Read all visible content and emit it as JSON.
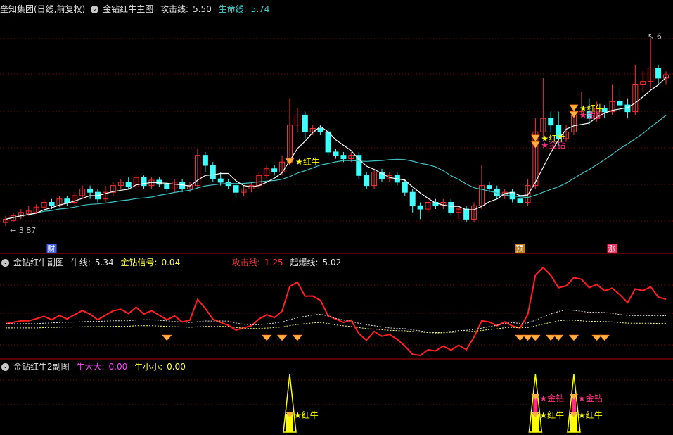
{
  "header_main": {
    "stock": "垒知集团(日线,前复权)",
    "indicator": "金钻红牛主图",
    "attack_label": "攻击线:",
    "attack_value": "5.50",
    "life_label": "生命线:",
    "life_value": "5.74"
  },
  "header_sub1": {
    "indicator": "金钻红牛副图",
    "bull_label": "牛线:",
    "bull_value": "5.34",
    "signal_label": "金钻信号:",
    "signal_value": "0.04",
    "attack_label": "攻击线:",
    "attack_value": "1.25",
    "burst_label": "起爆线:",
    "burst_value": "5.02"
  },
  "header_sub2": {
    "indicator": "金钻红牛2副图",
    "big_label": "牛大大:",
    "big_value": "0.00",
    "small_label": "牛小小:",
    "small_value": "0.00"
  },
  "colors": {
    "up": "#ff3030",
    "down": "#40ffff",
    "ma_attack": "#ffffff",
    "ma_life": "#40c0c0",
    "red_line": "#ff2020",
    "dashed_white": "#e0e0e0",
    "dashed_yellow": "#ffff60",
    "signal_yellow": "#ffff00",
    "tag_pink": "#ff3080",
    "grid": "#8b0000"
  },
  "chart_data": {
    "type": "candlestick",
    "min_label": "3.87",
    "max_label": "6",
    "candles": [
      [
        3.95,
        4.0,
        3.9,
        4.05
      ],
      [
        3.98,
        4.05,
        3.95,
        4.1
      ],
      [
        4.03,
        4.1,
        4.0,
        4.15
      ],
      [
        4.08,
        4.12,
        4.05,
        4.2
      ],
      [
        4.1,
        4.18,
        4.08,
        4.22
      ],
      [
        4.18,
        4.25,
        4.15,
        4.3
      ],
      [
        4.25,
        4.2,
        4.15,
        4.3
      ],
      [
        4.2,
        4.3,
        4.18,
        4.35
      ],
      [
        4.3,
        4.25,
        4.2,
        4.35
      ],
      [
        4.25,
        4.35,
        4.2,
        4.4
      ],
      [
        4.35,
        4.45,
        4.3,
        4.5
      ],
      [
        4.45,
        4.4,
        4.3,
        4.5
      ],
      [
        4.4,
        4.3,
        4.25,
        4.45
      ],
      [
        4.3,
        4.4,
        4.25,
        4.5
      ],
      [
        4.4,
        4.5,
        4.35,
        4.55
      ],
      [
        4.5,
        4.55,
        4.45,
        4.6
      ],
      [
        4.55,
        4.48,
        4.45,
        4.62
      ],
      [
        4.48,
        4.62,
        4.45,
        4.65
      ],
      [
        4.62,
        4.5,
        4.45,
        4.65
      ],
      [
        4.5,
        4.58,
        4.45,
        4.62
      ],
      [
        4.58,
        4.52,
        4.48,
        4.62
      ],
      [
        4.52,
        4.45,
        4.4,
        4.55
      ],
      [
        4.45,
        4.55,
        4.4,
        4.6
      ],
      [
        4.55,
        4.45,
        4.4,
        4.6
      ],
      [
        4.45,
        4.5,
        4.4,
        4.55
      ],
      [
        4.5,
        4.95,
        4.45,
        5.05
      ],
      [
        4.95,
        4.8,
        4.7,
        5.0
      ],
      [
        4.8,
        4.6,
        4.55,
        4.85
      ],
      [
        4.6,
        4.55,
        4.5,
        4.7
      ],
      [
        4.55,
        4.5,
        4.45,
        4.6
      ],
      [
        4.5,
        4.4,
        4.3,
        4.55
      ],
      [
        4.4,
        4.45,
        4.35,
        4.5
      ],
      [
        4.45,
        4.5,
        4.4,
        4.55
      ],
      [
        4.5,
        4.65,
        4.45,
        4.7
      ],
      [
        4.65,
        4.75,
        4.6,
        4.8
      ],
      [
        4.75,
        4.7,
        4.65,
        4.8
      ],
      [
        4.7,
        4.85,
        4.65,
        4.95
      ],
      [
        4.85,
        5.4,
        4.8,
        5.8
      ],
      [
        5.4,
        5.55,
        5.3,
        5.65
      ],
      [
        5.55,
        5.3,
        5.2,
        5.6
      ],
      [
        5.3,
        5.35,
        5.25,
        5.4
      ],
      [
        5.35,
        5.3,
        5.25,
        5.4
      ],
      [
        5.3,
        5.0,
        4.95,
        5.35
      ],
      [
        5.0,
        4.95,
        4.9,
        5.05
      ],
      [
        4.95,
        4.9,
        4.85,
        5.0
      ],
      [
        4.9,
        4.95,
        4.85,
        5.0
      ],
      [
        4.95,
        4.65,
        4.6,
        5.0
      ],
      [
        4.65,
        4.5,
        4.45,
        4.7
      ],
      [
        4.5,
        4.7,
        4.45,
        4.75
      ],
      [
        4.7,
        4.6,
        4.55,
        4.75
      ],
      [
        4.6,
        4.65,
        4.55,
        4.7
      ],
      [
        4.65,
        4.55,
        4.5,
        4.7
      ],
      [
        4.55,
        4.4,
        4.35,
        4.6
      ],
      [
        4.4,
        4.2,
        4.1,
        4.45
      ],
      [
        4.2,
        4.15,
        4.0,
        4.25
      ],
      [
        4.15,
        4.25,
        4.1,
        4.3
      ],
      [
        4.25,
        4.2,
        4.15,
        4.3
      ],
      [
        4.2,
        4.25,
        4.15,
        4.3
      ],
      [
        4.25,
        4.1,
        4.05,
        4.3
      ],
      [
        4.1,
        4.15,
        4.0,
        4.2
      ],
      [
        4.15,
        4.0,
        3.95,
        4.2
      ],
      [
        4.0,
        4.2,
        3.95,
        4.25
      ],
      [
        4.2,
        4.5,
        4.15,
        4.8
      ],
      [
        4.5,
        4.45,
        4.4,
        4.55
      ],
      [
        4.45,
        4.35,
        4.3,
        4.5
      ],
      [
        4.35,
        4.4,
        4.3,
        4.45
      ],
      [
        4.4,
        4.3,
        4.25,
        4.45
      ],
      [
        4.3,
        4.25,
        4.2,
        4.35
      ],
      [
        4.25,
        4.5,
        4.2,
        4.6
      ],
      [
        4.5,
        5.3,
        4.45,
        5.5
      ],
      [
        5.3,
        5.5,
        5.2,
        6.1
      ],
      [
        5.5,
        5.4,
        5.3,
        5.6
      ],
      [
        5.4,
        5.2,
        5.1,
        5.6
      ],
      [
        5.2,
        5.3,
        5.15,
        5.4
      ],
      [
        5.3,
        5.55,
        5.25,
        5.6
      ],
      [
        5.55,
        5.6,
        5.5,
        5.9
      ],
      [
        5.6,
        5.5,
        5.4,
        5.8
      ],
      [
        5.5,
        5.65,
        5.45,
        5.75
      ],
      [
        5.65,
        5.6,
        5.5,
        5.7
      ],
      [
        5.6,
        5.75,
        5.55,
        6.0
      ],
      [
        5.75,
        5.7,
        5.6,
        5.95
      ],
      [
        5.7,
        5.6,
        5.5,
        5.8
      ],
      [
        5.6,
        6.0,
        5.55,
        6.3
      ],
      [
        6.0,
        6.05,
        5.9,
        6.2
      ],
      [
        6.05,
        6.25,
        5.95,
        6.7
      ],
      [
        6.25,
        6.1,
        6.0,
        6.3
      ],
      [
        6.1,
        6.15,
        6.0,
        6.2
      ]
    ],
    "bottom_markers": [
      "财",
      "预",
      "涨"
    ],
    "signal_labels": [
      "红牛",
      "金钻"
    ]
  }
}
